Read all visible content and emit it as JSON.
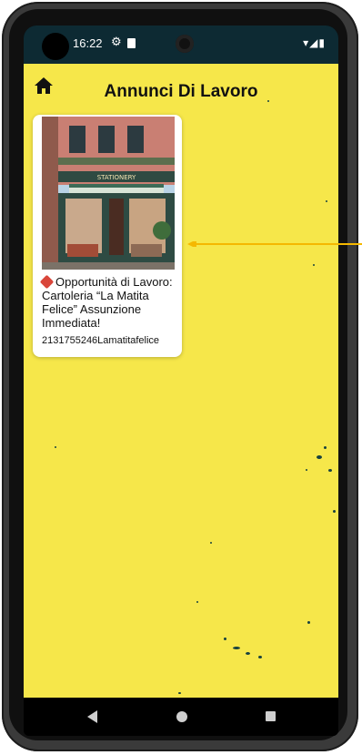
{
  "status_bar": {
    "time": "16:22",
    "icons": [
      "gear-icon",
      "sd-card-icon",
      "wifi-icon",
      "signal-icon",
      "battery-icon"
    ]
  },
  "header": {
    "title": "Annunci Di Lavoro",
    "home_icon": "home-icon"
  },
  "listings": [
    {
      "image": "stationery-shop-photo",
      "image_sign": "STATIONERY",
      "title": "Opportunità di Lavoro: Cartoleria “La Matita Felice” Assunzione Immediata!",
      "subtitle": "2131755246Lamatitafelice",
      "badge_icon": "pushpin-icon"
    }
  ],
  "navigation": {
    "back": "back-icon",
    "home": "home-circle-icon",
    "recents": "recents-icon"
  },
  "colors": {
    "background": "#f6e74a",
    "status_bar": "#0d2a33",
    "annotation_arrow": "#f5b800"
  }
}
